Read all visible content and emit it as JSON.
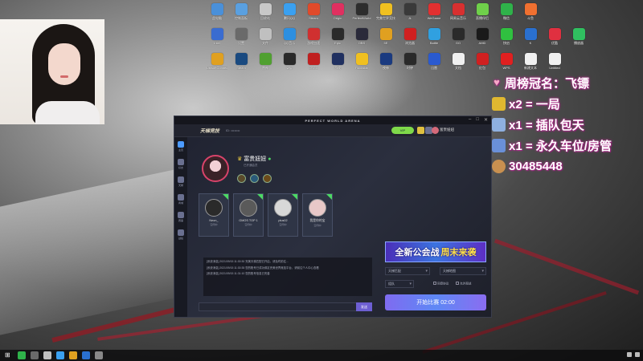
{
  "desktop": {
    "icon_rows": [
      [
        {
          "label": "此电脑",
          "color": "#4a90d9"
        },
        {
          "label": "控制面板",
          "color": "#5aa0e0"
        },
        {
          "label": "回收站",
          "color": "#c8c8c8"
        },
        {
          "label": "腾讯QQ",
          "color": "#3aa0f0"
        },
        {
          "label": "Steam",
          "color": "#e04a2a"
        },
        {
          "label": "Origin",
          "color": "#e03060"
        },
        {
          "label": "PerfectWorld",
          "color": "#2d2d2d"
        },
        {
          "label": "完美世界竞技",
          "color": "#f0c020"
        },
        {
          "label": "JL",
          "color": "#3a3a3a"
        },
        {
          "label": "WeGame",
          "color": "#e23030"
        },
        {
          "label": "网易云音乐",
          "color": "#d83030"
        },
        {
          "label": "直播伴侣",
          "color": "#6fd04a"
        },
        {
          "label": "微信",
          "color": "#2fb24a"
        },
        {
          "label": "斗鱼",
          "color": "#f07030"
        }
      ],
      [
        {
          "label": "Intel",
          "color": "#3a6cd0"
        },
        {
          "label": "设置",
          "color": "#6a6a6a"
        },
        {
          "label": "文件",
          "color": "#c0c0c0"
        },
        {
          "label": "QQ音乐",
          "color": "#2d8fe0"
        },
        {
          "label": "游戏加速",
          "color": "#d03030"
        },
        {
          "label": "Epic",
          "color": "#2a2a2a"
        },
        {
          "label": "OBS",
          "color": "#2a2a3a"
        },
        {
          "label": "5E",
          "color": "#e0a020"
        },
        {
          "label": "浏览器",
          "color": "#d02020"
        },
        {
          "label": "Battle",
          "color": "#30a0e0"
        },
        {
          "label": "GO",
          "color": "#2a2a2a"
        },
        {
          "label": "AMD",
          "color": "#1a1a1a"
        },
        {
          "label": "快启",
          "color": "#30c040"
        },
        {
          "label": "K",
          "color": "#2a70d0"
        },
        {
          "label": "优酷",
          "color": "#e03040"
        },
        {
          "label": "播放器",
          "color": "#30c060"
        }
      ],
      [
        {
          "label": "UbisoftConnect",
          "color": "#e0a020"
        },
        {
          "label": "Steam",
          "color": "#1a4a80"
        },
        {
          "label": "雷神",
          "color": "#50a030"
        },
        {
          "label": "录屏",
          "color": "#2a2a2a"
        },
        {
          "label": "CSGO",
          "color": "#c02020"
        },
        {
          "label": "游戏",
          "color": "#203060"
        },
        {
          "label": "Rockstar",
          "color": "#f0c020"
        },
        {
          "label": "夜神",
          "color": "#1a3a80"
        },
        {
          "label": "时钟",
          "color": "#2a2a2a"
        },
        {
          "label": "迅雷",
          "color": "#2a5ad0"
        },
        {
          "label": "文档",
          "color": "#f0f0f0"
        },
        {
          "label": "红包",
          "color": "#d02020"
        },
        {
          "label": "WPS",
          "color": "#e02020"
        },
        {
          "label": "新建文本",
          "color": "#f0f0f0"
        },
        {
          "label": "Untitled",
          "color": "#f0f0f0"
        }
      ]
    ]
  },
  "overlay": {
    "title": "周榜冠名：飞镖",
    "line1": "x2 = 一局",
    "line2": "x1 = 插队包天",
    "line3": "x1 = 永久车位/房管",
    "line4": "30485448"
  },
  "client": {
    "window_title": "PERFECT WORLD ARENA",
    "logo": "天梯竞技",
    "user_id_label": "ID: ••••••••",
    "badge_pill": "VIP",
    "top_username": "富贵妞妞",
    "sidebar": [
      "主页",
      "好友",
      "天梯",
      "商城",
      "赛事",
      "战绩"
    ],
    "profile": {
      "name": "富贵妞妞",
      "sub": "已开通会员"
    },
    "friends": [
      {
        "name": "Neon_",
        "status": "空闲中"
      },
      {
        "name": "GMOS TOP 1",
        "status": "空闲中"
      },
      {
        "name": "plus02",
        "status": "空闲中"
      },
      {
        "name": "我是你的宝",
        "status": "空闲中"
      }
    ],
    "log": [
      "[系统消息] 2021/09/15 11:30:30 完美天梯匹配已开启，请及时前往...",
      "[系统消息] 2021/09/15 11:30:35 您的账号已成功绑定完美世界竞技平台，请前往个人中心查看",
      "[系统消息] 2021/09/15 11:31:10 您的账号信息已完善"
    ],
    "send_label": "发送",
    "banner": {
      "part1": "全新公会战",
      "part2": "周末来袭"
    },
    "dropdowns": [
      "天梯匹配",
      "天梯地图",
      "组队"
    ],
    "checks": [
      "同意协议",
      "允许观战"
    ],
    "match_button": "开始比赛 02:00"
  },
  "taskbar": {
    "icons": [
      "#2fb24a",
      "#6a6a6a",
      "#c0c0c0",
      "#3aa0f0",
      "#e0a020",
      "#2a70d0",
      "#888"
    ]
  }
}
